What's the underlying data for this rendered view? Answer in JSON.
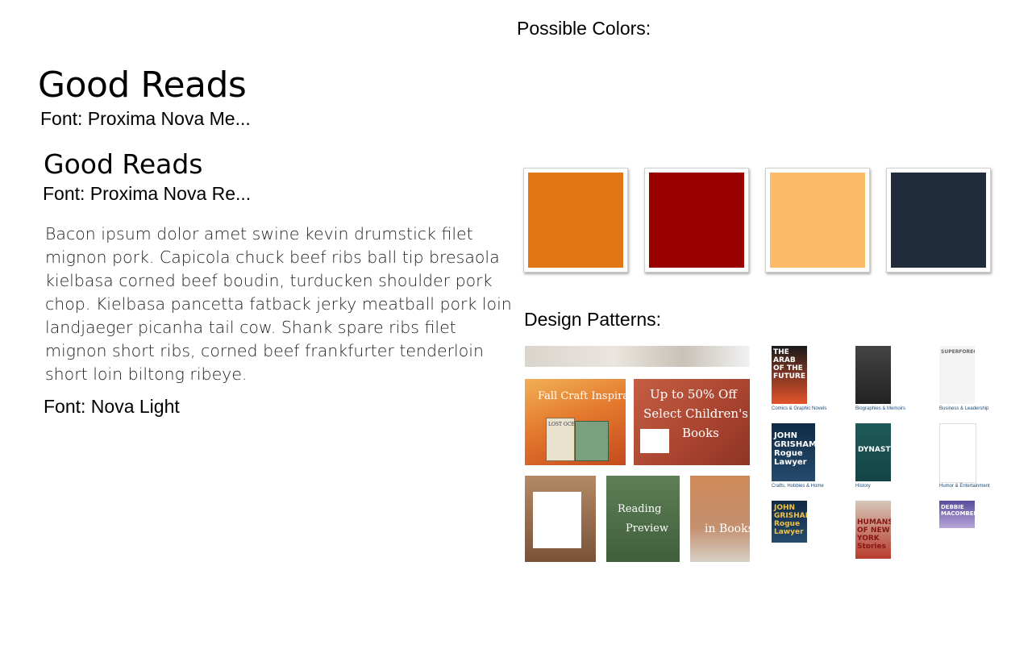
{
  "typography": {
    "heading_medium": "Good Reads",
    "heading_medium_font": "Font: Proxima Nova Me...",
    "heading_regular": "Good Reads",
    "heading_regular_font": "Font: Proxima Nova Re...",
    "body_text": "Bacon ipsum dolor amet swine kevin drumstick filet mignon pork. Capicola chuck beef ribs ball tip bresaola kielbasa corned beef boudin, turducken shoulder pork chop. Kielbasa pancetta fatback jerky meatball pork loin landjaeger picanha tail cow. Shank spare ribs filet mignon short ribs, corned beef frankfurter tenderloin short loin biltong ribeye.",
    "body_font": "Font: Nova Light"
  },
  "colors": {
    "heading": "Possible Colors:",
    "swatches": [
      "#E07614",
      "#990000",
      "#FDBB68",
      "#202C3C"
    ]
  },
  "patterns": {
    "heading": "Design Patterns:",
    "promo_tiles": {
      "fall_craft": "Fall Craft Inspiration",
      "lost_ocean": "LOST OCEAN",
      "up_to": "Up to 50% Off",
      "select_children": "Select Children's",
      "books": "Books",
      "reading": "Reading",
      "preview": "Preview",
      "in_books": "in Books"
    },
    "categories": [
      {
        "label": "Comics & Graphic Novels",
        "cover": "THE ARAB OF THE FUTURE"
      },
      {
        "label": "Biographies & Memoirs",
        "cover": ""
      },
      {
        "label": "Business & Leadership",
        "cover": "SUPERFORECASTING"
      },
      {
        "label": "Crafts, Hobbies & Home",
        "cover": "JOHN GRISHAM Rogue Lawyer"
      },
      {
        "label": "History",
        "cover": "DYNASTY"
      },
      {
        "label": "Humor & Entertainment",
        "cover": ""
      },
      {
        "label": "",
        "cover": "JOHN GRISHAM Rogue Lawyer"
      },
      {
        "label": "",
        "cover": "HUMANS OF NEW YORK Stories"
      },
      {
        "label": "",
        "cover": "DEBBIE MACOMBER"
      }
    ]
  }
}
